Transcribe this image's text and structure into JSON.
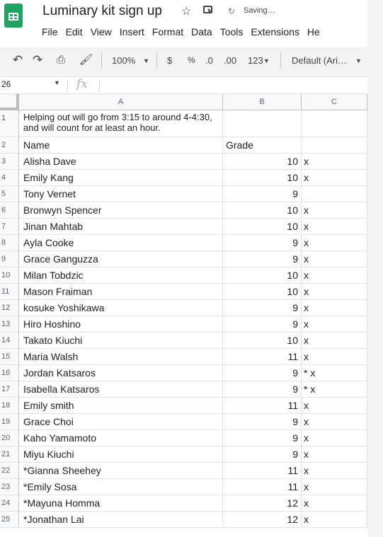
{
  "app": {
    "title": "Luminary kit sign up",
    "saving_text": "Saving…",
    "icons": [
      "sheets-logo-icon",
      "star-icon",
      "move-to-folder-icon",
      "cloud-sync-icon"
    ]
  },
  "menu": [
    "File",
    "Edit",
    "View",
    "Insert",
    "Format",
    "Data",
    "Tools",
    "Extensions",
    "He"
  ],
  "toolbar": {
    "zoom": "100%",
    "currency": "$",
    "percent": "%",
    "dec_decrease": ".0",
    "dec_increase": ".00",
    "format_more": "123",
    "font": "Default (Ari…"
  },
  "formula_bar": {
    "name_box": "26",
    "fx": "fx",
    "content": ""
  },
  "columns": [
    "A",
    "B",
    "C"
  ],
  "rows": [
    {
      "num": "1",
      "a": "Helping out will go from 3:15 to around 4-4:30, and will count for at least an hour.",
      "b": "",
      "c": ""
    },
    {
      "num": "2",
      "a": "Name",
      "b": "Grade",
      "c": ""
    },
    {
      "num": "3",
      "a": "Alisha Dave",
      "b": "10",
      "c": "x"
    },
    {
      "num": "4",
      "a": "Emily Kang",
      "b": "10",
      "c": "x"
    },
    {
      "num": "5",
      "a": "Tony Vernet",
      "b": "9",
      "c": ""
    },
    {
      "num": "6",
      "a": "Bronwyn Spencer",
      "b": "10",
      "c": "x"
    },
    {
      "num": "7",
      "a": "Jinan Mahtab",
      "b": "10",
      "c": "x"
    },
    {
      "num": "8",
      "a": "Ayla Cooke",
      "b": "9",
      "c": "x"
    },
    {
      "num": "9",
      "a": "Grace Ganguzza",
      "b": "9",
      "c": "x"
    },
    {
      "num": "10",
      "a": "Milan Tobdzic",
      "b": "10",
      "c": "x"
    },
    {
      "num": "11",
      "a": "Mason Fraiman",
      "b": "10",
      "c": "x"
    },
    {
      "num": "12",
      "a": "kosuke Yoshikawa",
      "b": "9",
      "c": "x"
    },
    {
      "num": "13",
      "a": "Hiro Hoshino",
      "b": "9",
      "c": "x"
    },
    {
      "num": "14",
      "a": "Takato Kiuchi",
      "b": "10",
      "c": "x"
    },
    {
      "num": "15",
      "a": "Maria Walsh",
      "b": "11",
      "c": "x"
    },
    {
      "num": "16",
      "a": "Jordan Katsaros",
      "b": "9",
      "c": "* x"
    },
    {
      "num": "17",
      "a": "Isabella Katsaros",
      "b": "9",
      "c": "* x"
    },
    {
      "num": "18",
      "a": "Emily smith",
      "b": "11",
      "c": "x"
    },
    {
      "num": "19",
      "a": "Grace Choi",
      "b": "9",
      "c": "x"
    },
    {
      "num": "20",
      "a": "Kaho Yamamoto",
      "b": "9",
      "c": "x"
    },
    {
      "num": "21",
      "a": "Miyu Kiuchi",
      "b": "9",
      "c": "x"
    },
    {
      "num": "22",
      "a": "*Gianna Sheehey",
      "b": "11",
      "c": "x"
    },
    {
      "num": "23",
      "a": "*Emily Sosa",
      "b": "11",
      "c": "x"
    },
    {
      "num": "24",
      "a": "*Mayuna Homma",
      "b": "12",
      "c": "x"
    },
    {
      "num": "25",
      "a": "*Jonathan Lai",
      "b": "12",
      "c": "x"
    }
  ]
}
